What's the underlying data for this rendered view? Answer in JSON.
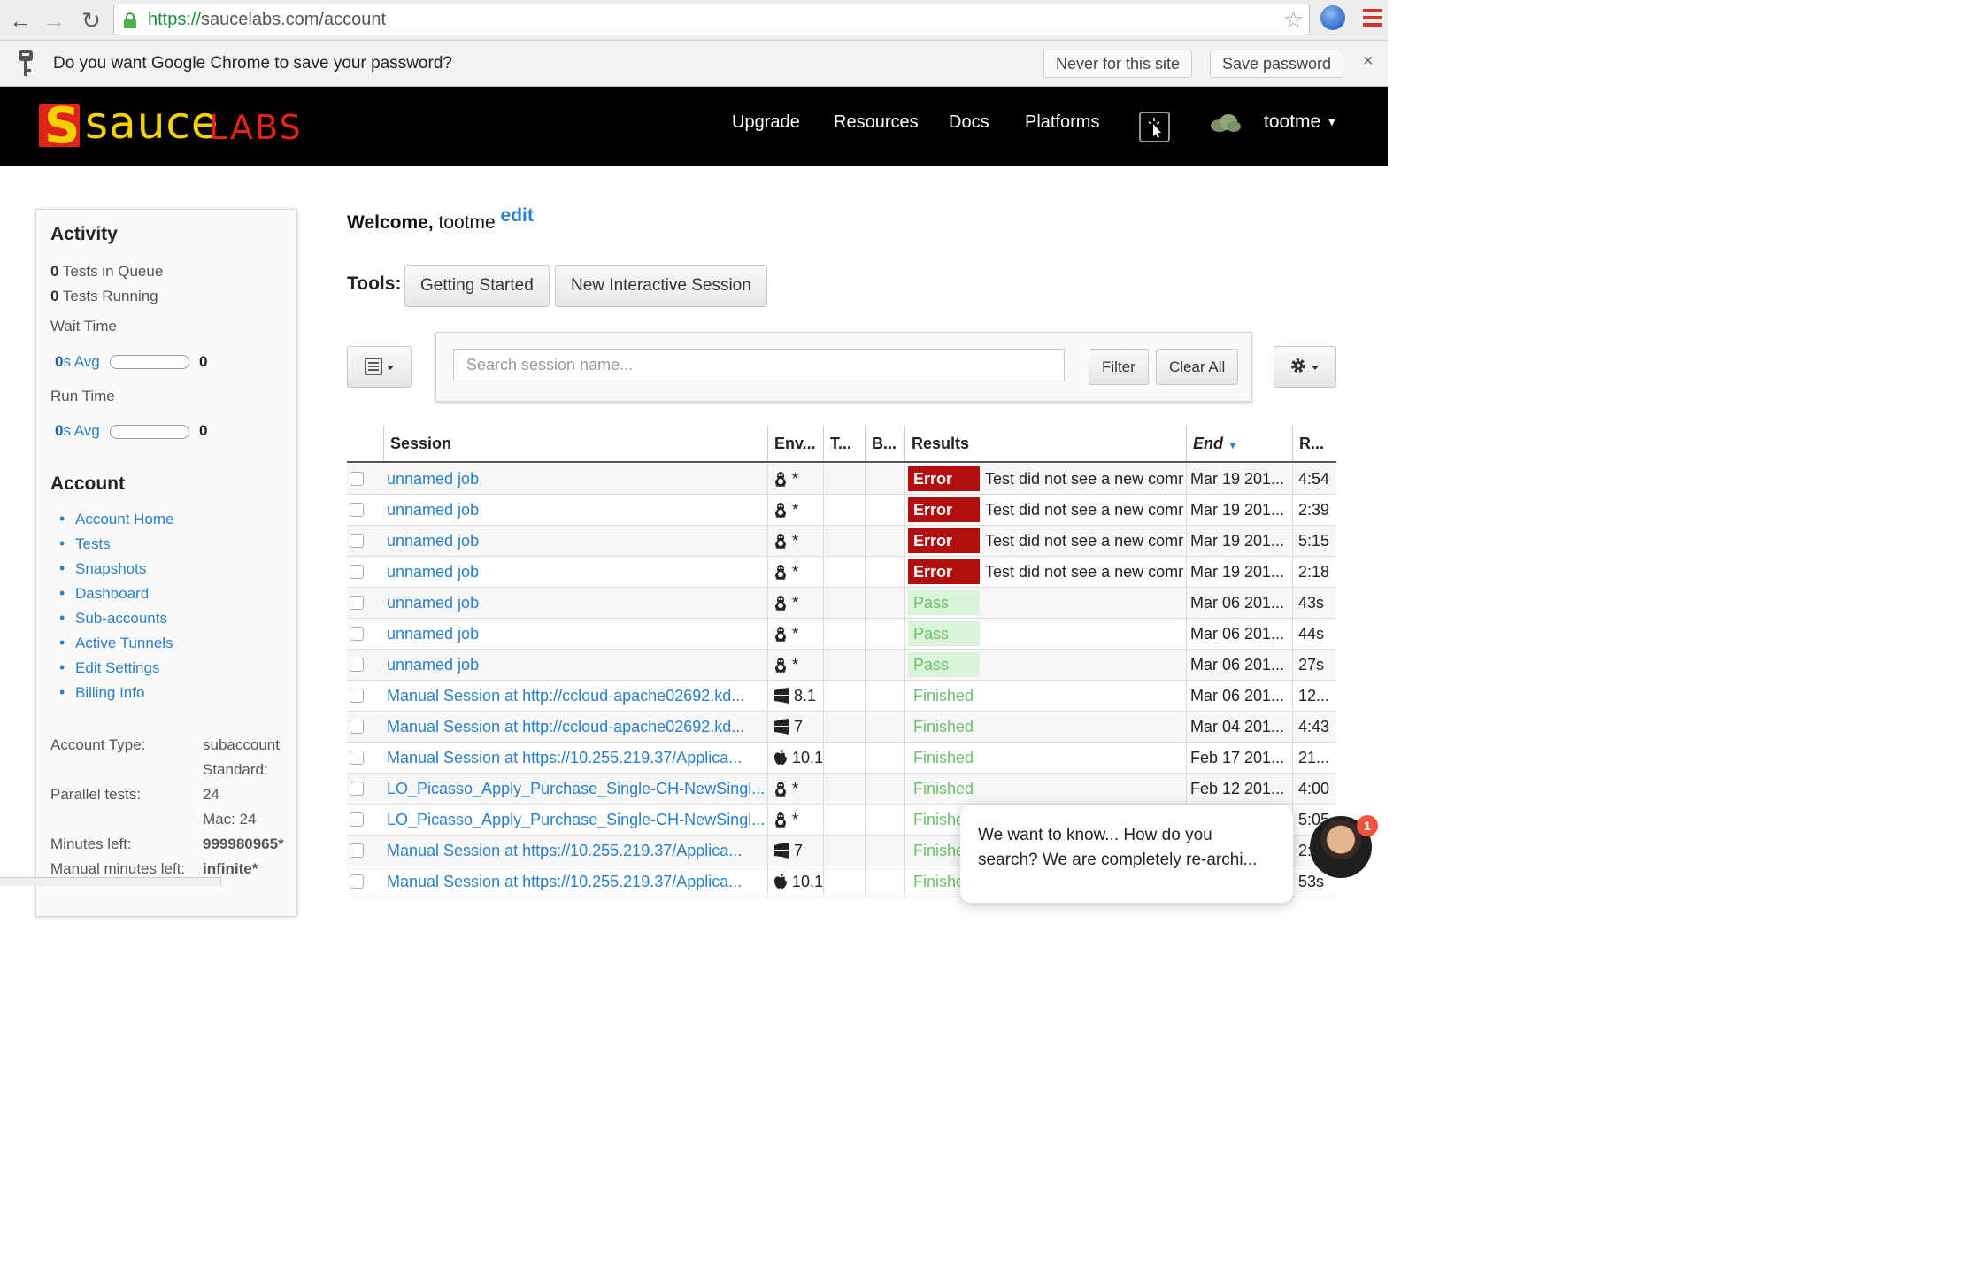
{
  "browser": {
    "url_scheme": "https://",
    "url_rest": "saucelabs.com/account",
    "password_prompt": "Do you want Google Chrome to save your password?",
    "never_label": "Never for this site",
    "save_label": "Save password",
    "close_glyph": "×"
  },
  "header": {
    "logo_sauce": "sauce",
    "logo_labs": "LABS",
    "nav": [
      "Upgrade",
      "Resources",
      "Docs",
      "Platforms"
    ],
    "user": "tootme"
  },
  "sidebar": {
    "activity_title": "Activity",
    "queue_count": "0",
    "queue_label": "Tests in Queue",
    "running_count": "0",
    "running_label": "Tests Running",
    "wait_label": "Wait Time",
    "wait_avg_value": "0",
    "wait_avg_label": "s Avg",
    "wait_count": "0",
    "run_label": "Run Time",
    "run_avg_value": "0",
    "run_avg_label": "s Avg",
    "run_count": "0",
    "account_title": "Account",
    "links": [
      "Account Home",
      "Tests",
      "Snapshots",
      "Dashboard",
      "Sub-accounts",
      "Active Tunnels",
      "Edit Settings",
      "Billing Info"
    ],
    "account_type_label": "Account Type:",
    "account_type_value": "subaccount",
    "standard_label": "Standard:",
    "parallel_label": "Parallel tests:",
    "parallel_value": "24",
    "mac_value": "Mac: 24",
    "minutes_label": "Minutes left:",
    "minutes_value": "999980965*",
    "manual_label": "Manual minutes left:",
    "manual_value": "infinite*"
  },
  "main": {
    "welcome_prefix": "Welcome,",
    "welcome_user": "tootme",
    "edit_label": "edit",
    "tools_label": "Tools:",
    "tool_buttons": [
      "Getting Started",
      "New Interactive Session"
    ],
    "search_placeholder": "Search session name...",
    "filter_label": "Filter",
    "clear_label": "Clear All"
  },
  "table": {
    "columns": [
      "Session",
      "Env...",
      "T...",
      "B...",
      "Results",
      "End",
      "R..."
    ],
    "rows": [
      {
        "session": "unnamed job",
        "env": "*",
        "result": "Error",
        "note": "Test did not see a new command",
        "end": "Mar 19 201...",
        "run": "4:54"
      },
      {
        "session": "unnamed job",
        "env": "*",
        "result": "Error",
        "note": "Test did not see a new command",
        "end": "Mar 19 201...",
        "run": "2:39"
      },
      {
        "session": "unnamed job",
        "env": "*",
        "result": "Error",
        "note": "Test did not see a new command",
        "end": "Mar 19 201...",
        "run": "5:15"
      },
      {
        "session": "unnamed job",
        "env": "*",
        "result": "Error",
        "note": "Test did not see a new command",
        "end": "Mar 19 201...",
        "run": "2:18"
      },
      {
        "session": "unnamed job",
        "env": "*",
        "result": "Pass",
        "note": "",
        "end": "Mar 06 201...",
        "run": "43s"
      },
      {
        "session": "unnamed job",
        "env": "*",
        "result": "Pass",
        "note": "",
        "end": "Mar 06 201...",
        "run": "44s"
      },
      {
        "session": "unnamed job",
        "env": "*",
        "result": "Pass",
        "note": "",
        "end": "Mar 06 201...",
        "run": "27s"
      },
      {
        "session": "Manual Session at http://ccloud-apache02692.kd...",
        "env": "8.1",
        "result": "Finished",
        "note": "",
        "end": "Mar 06 201...",
        "run": "12..."
      },
      {
        "session": "Manual Session at http://ccloud-apache02692.kd...",
        "env": "7",
        "result": "Finished",
        "note": "",
        "end": "Mar 04 201...",
        "run": "4:43"
      },
      {
        "session": "Manual Session at https://10.255.219.37/Applica...",
        "env": "10.1",
        "result": "Finished",
        "note": "",
        "end": "Feb 17 201...",
        "run": "21..."
      },
      {
        "session": "LO_Picasso_Apply_Purchase_Single-CH-NewSingl...",
        "env": "*",
        "result": "Finished",
        "note": "",
        "end": "Feb 12 201...",
        "run": "4:00"
      },
      {
        "session": "LO_Picasso_Apply_Purchase_Single-CH-NewSingl...",
        "env": "*",
        "result": "Finished",
        "note": "",
        "end": "",
        "run": "5:05"
      },
      {
        "session": "Manual Session at https://10.255.219.37/Applica...",
        "env": "7",
        "result": "Finished",
        "note": "",
        "end": "",
        "run": "2:"
      },
      {
        "session": "Manual Session at https://10.255.219.37/Applica...",
        "env": "10.1",
        "result": "Finished",
        "note": "",
        "end": "",
        "run": "53s"
      }
    ]
  },
  "chat": {
    "line1": "We want to know... How do you",
    "line2": "search? We are completely re-archi...",
    "badge": "1"
  },
  "colors": {
    "link": "#2a7fc9",
    "error": "#b30e0e",
    "pass_bg": "#d9f4d9",
    "pass_text": "#6cbf6c",
    "brand_yellow": "#f5d100",
    "brand_red": "#e2231a"
  }
}
